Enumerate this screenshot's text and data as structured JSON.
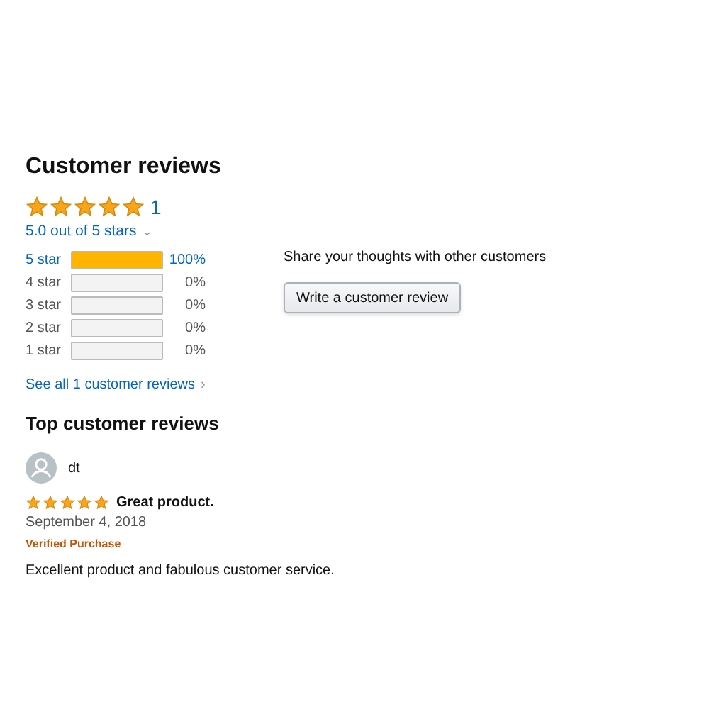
{
  "summary": {
    "title": "Customer reviews",
    "stars": 5,
    "count": "1",
    "rating_text": "5.0 out of 5 stars",
    "caret": "⌄"
  },
  "histogram": [
    {
      "label": "5 star",
      "level": 1,
      "percent": "100%"
    },
    {
      "label": "4 star",
      "level": 0,
      "percent": "0%"
    },
    {
      "label": "3 star",
      "level": 0,
      "percent": "0%"
    },
    {
      "label": "2 star",
      "level": 0,
      "percent": "0%"
    },
    {
      "label": "1 star",
      "level": 0,
      "percent": "0%"
    }
  ],
  "see_all": {
    "text": "See all 1 customer reviews",
    "chevron": "›"
  },
  "share": {
    "text": "Share your thoughts with other customers",
    "button": "Write a customer review"
  },
  "top_reviews": {
    "title": "Top customer reviews",
    "reviews": [
      {
        "author": "dt",
        "stars": 5,
        "headline": "Great product.",
        "date": "September 4, 2018",
        "badge": "Verified Purchase",
        "body": "Excellent product and fabulous customer service."
      }
    ]
  }
}
